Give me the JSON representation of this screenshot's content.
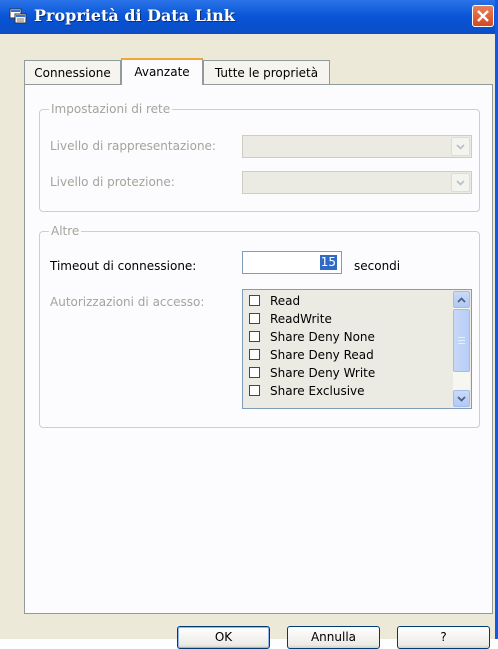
{
  "window": {
    "title": "Proprietà di Data Link"
  },
  "icons": {
    "app": "data-link-icon",
    "close": "close-icon",
    "dropdown": "chevron-down-icon",
    "scroll_up": "chevron-up-icon",
    "scroll_down": "chevron-down-icon"
  },
  "tabs": [
    {
      "label": "Connessione",
      "active": false
    },
    {
      "label": "Avanzate",
      "active": true
    },
    {
      "label": "Tutte le proprietà",
      "active": false
    }
  ],
  "network_group": {
    "title": "Impostazioni di rete",
    "impersonation_label": "Livello di rappresentazione:",
    "impersonation_value": "",
    "protection_label": "Livello di protezione:",
    "protection_value": ""
  },
  "other_group": {
    "title": "Altre",
    "timeout_label": "Timeout di connessione:",
    "timeout_value": "15",
    "timeout_unit": "secondi",
    "access_label": "Autorizzazioni di accesso:",
    "access_items": [
      {
        "label": "Read",
        "checked": false
      },
      {
        "label": "ReadWrite",
        "checked": false
      },
      {
        "label": "Share Deny None",
        "checked": false
      },
      {
        "label": "Share Deny Read",
        "checked": false
      },
      {
        "label": "Share Deny Write",
        "checked": false
      },
      {
        "label": "Share Exclusive",
        "checked": false
      }
    ]
  },
  "buttons": {
    "ok": "OK",
    "cancel": "Annulla",
    "help": "?"
  },
  "colors": {
    "titlebar": "#0a57d8",
    "dialog_bg": "#ece9d8",
    "panel_bg": "#fcfcfe",
    "active_tab_accent": "#f2a735",
    "selection": "#316ac5",
    "close_button": "#d4481f"
  }
}
